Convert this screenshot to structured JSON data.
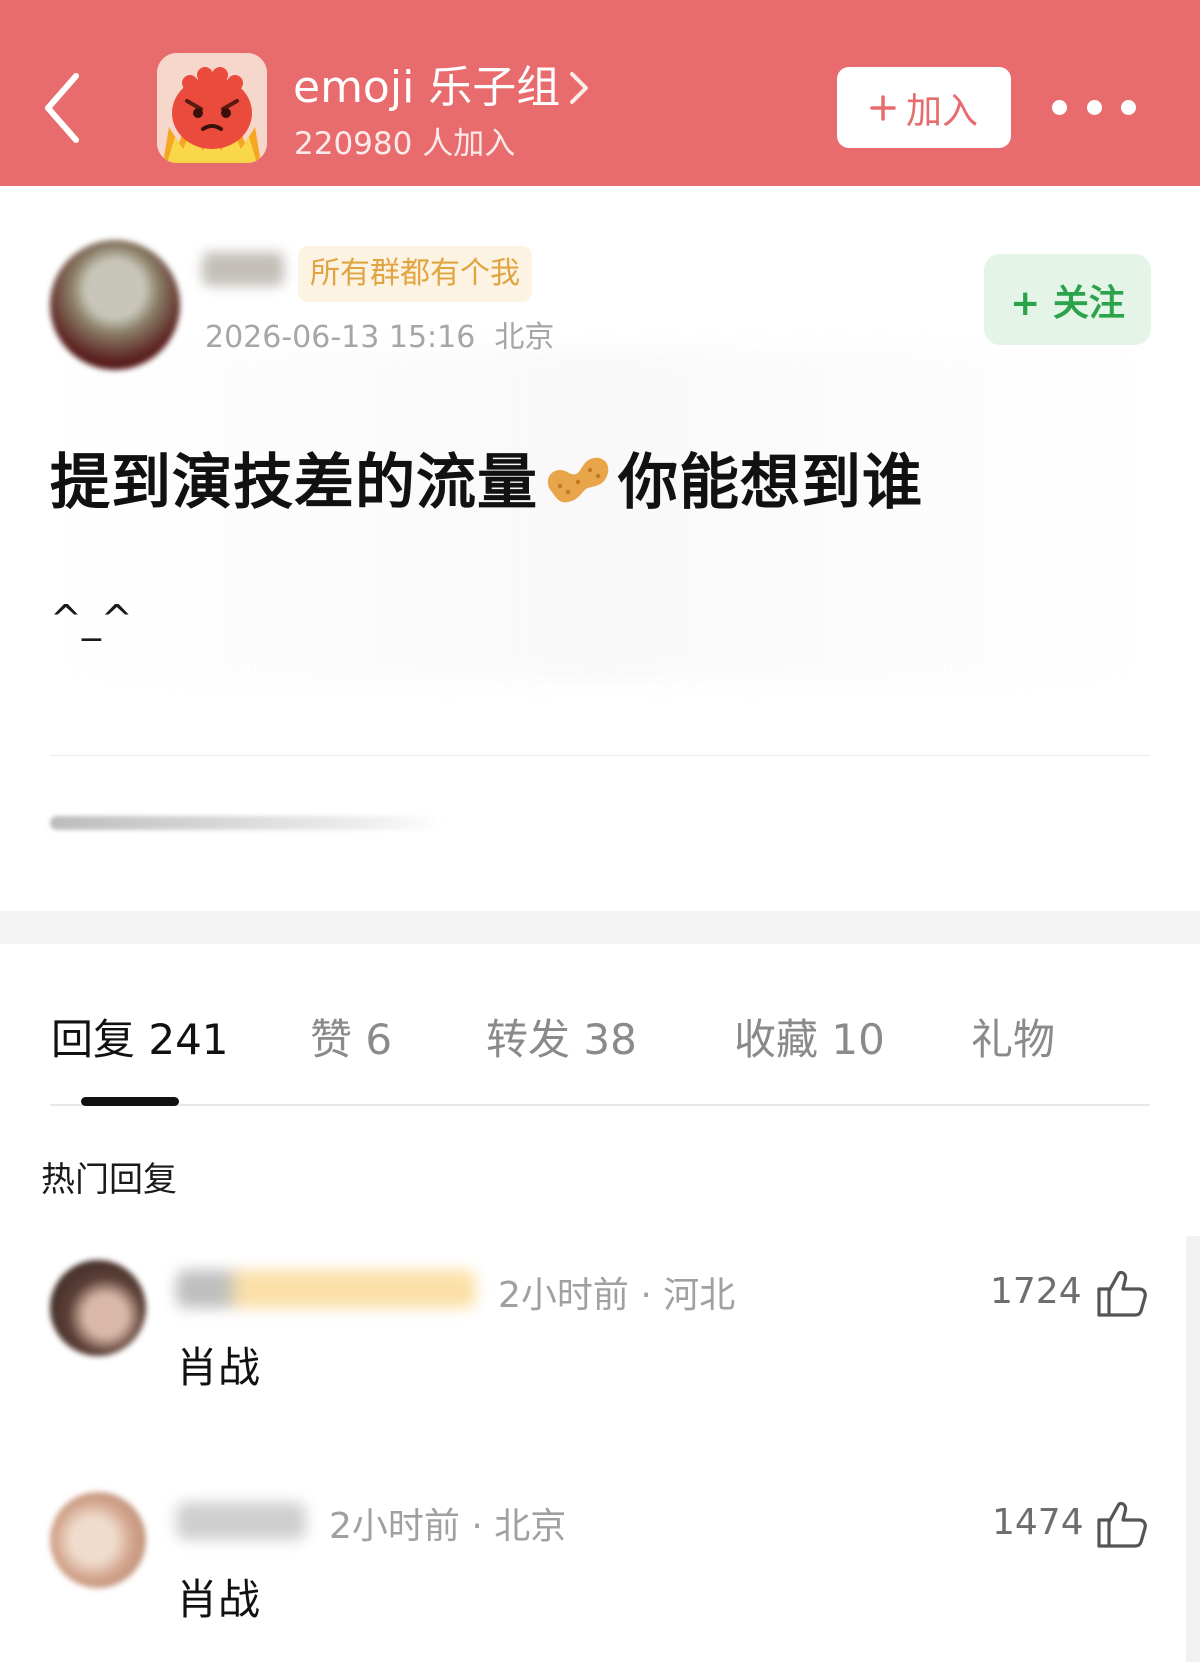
{
  "header": {
    "group_name": "emoji 乐子组",
    "members": "220980 人加入",
    "join_label": "加入",
    "colors": {
      "header_bg": "#e86c6e",
      "join_text": "#e86c6e"
    },
    "icons": {
      "back": "chevron-left-icon",
      "group_arrow": "chevron-right-icon",
      "join": "plus-icon",
      "more": "more-dots-icon"
    }
  },
  "post": {
    "author_badge": "所有群都有个我",
    "timestamp": "2026-06-13 15:16",
    "location": "北京",
    "follow_label": "+ 关注",
    "title_before": "提到演技差的流量",
    "title_emoji": "peanut-emoji",
    "title_after": "你能想到谁",
    "body": "^_^",
    "colors": {
      "badge_text": "#e0a541",
      "follow_text": "#2aa34a"
    }
  },
  "tabs": [
    {
      "label": "回复 241",
      "active": true
    },
    {
      "label": "赞 6",
      "active": false
    },
    {
      "label": "转发 38",
      "active": false
    },
    {
      "label": "收藏 10",
      "active": false
    },
    {
      "label": "礼物",
      "active": false
    }
  ],
  "hot_replies": {
    "heading": "热门回复",
    "items": [
      {
        "time": "2小时前",
        "location": "河北",
        "text": "肖战",
        "likes": "1724",
        "like_icon": "thumbs-up-icon"
      },
      {
        "time": "2小时前",
        "location": "北京",
        "text": "肖战",
        "likes": "1474",
        "like_icon": "thumbs-up-icon"
      }
    ]
  }
}
